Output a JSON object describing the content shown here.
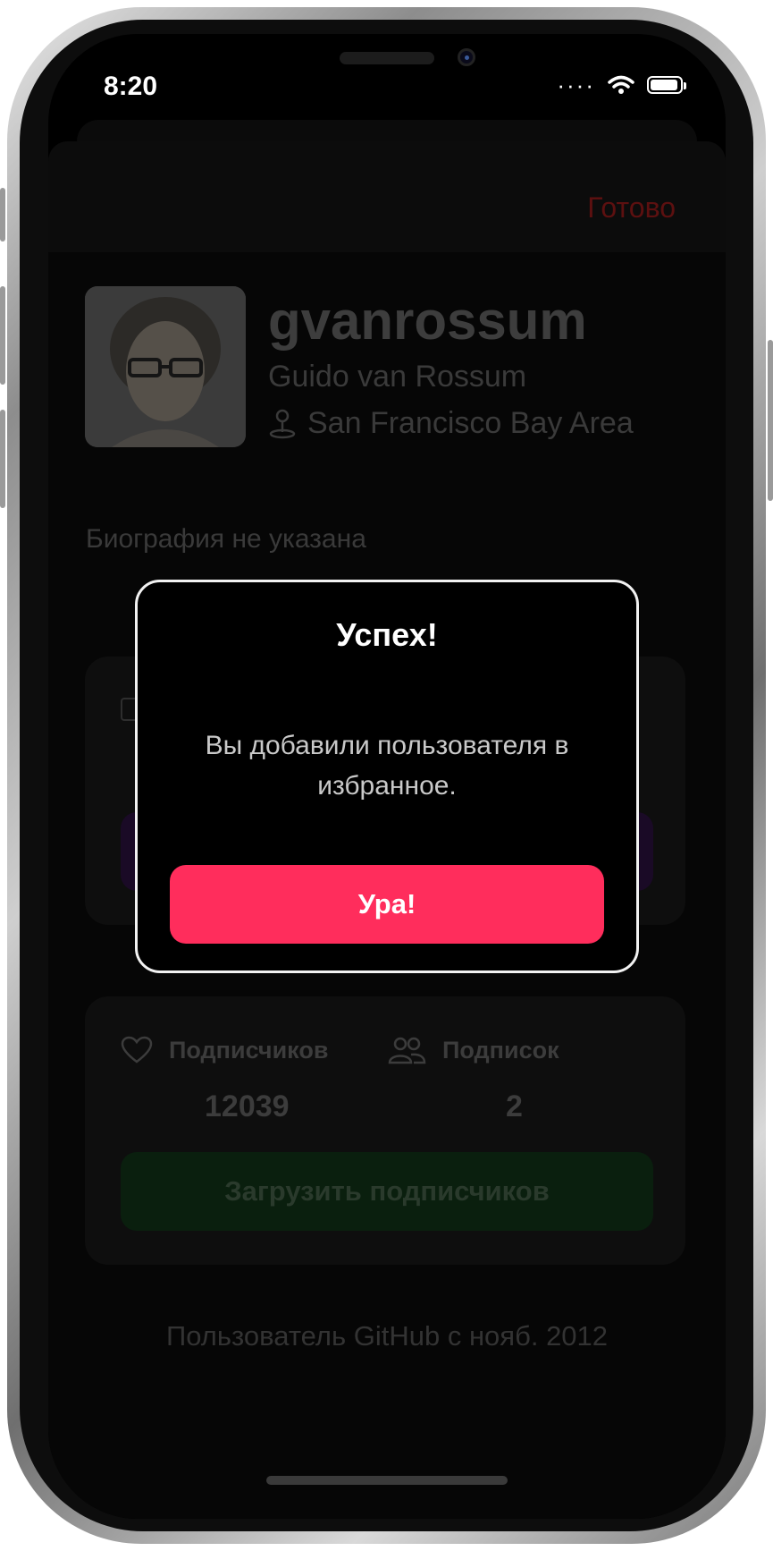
{
  "status_bar": {
    "time": "8:20"
  },
  "navbar": {
    "done_label": "Готово"
  },
  "profile": {
    "username": "gvanrossum",
    "full_name": "Guido van Rossum",
    "location": "San Francisco Bay Area",
    "bio": "Биография не указана"
  },
  "stats": {
    "followers_label": "Подписчиков",
    "followers_value": "12039",
    "following_label": "Подписок",
    "following_value": "2",
    "load_followers_label": "Загрузить подписчиков"
  },
  "footer": {
    "member_since": "Пользователь GitHub с нояб. 2012"
  },
  "alert": {
    "title": "Успех!",
    "message": "Вы добавили пользователя в избранное.",
    "button_label": "Ура!"
  },
  "colors": {
    "accent": "#ff2d5c",
    "done_dimmed": "#5c1010",
    "green_button_dimmed": "#0a1f0e",
    "purple_button_dimmed": "#1a0a26"
  },
  "icons": [
    "wifi-icon",
    "battery-icon",
    "location-pin-icon",
    "heart-icon",
    "people-icon",
    "calendar-icon"
  ]
}
